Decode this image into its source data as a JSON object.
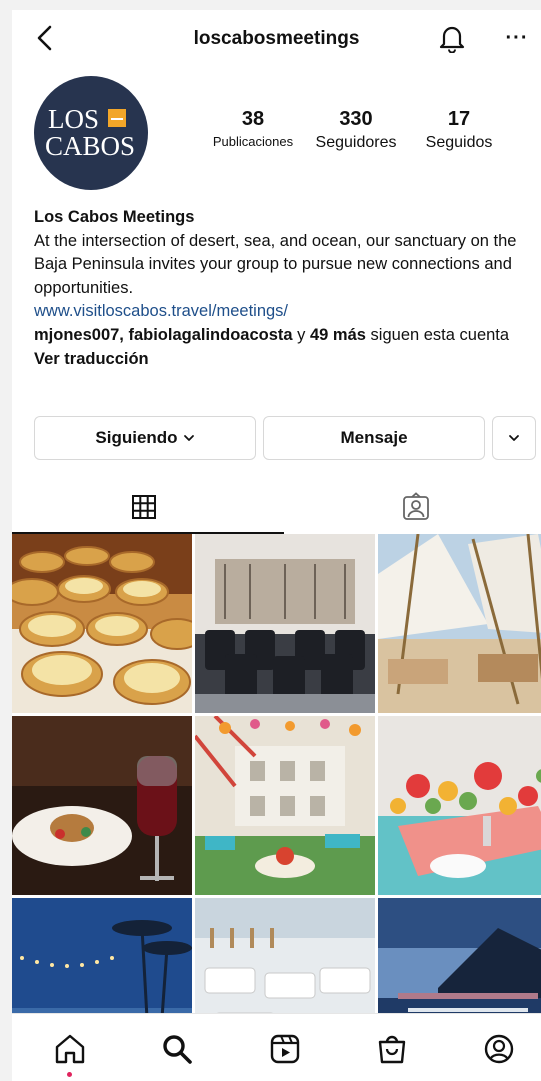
{
  "header": {
    "username": "loscabosmeetings",
    "back_icon": "chevron-left-icon",
    "bell_icon": "bell-icon",
    "more_label": "···"
  },
  "profile": {
    "avatar_line1": "LOS",
    "avatar_line2": "CABOS",
    "stats": [
      {
        "value": "38",
        "label": "Publicaciones"
      },
      {
        "value": "330",
        "label": "Seguidores"
      },
      {
        "value": "17",
        "label": "Seguidos"
      }
    ]
  },
  "bio": {
    "name": "Los Cabos Meetings",
    "text": "At the intersection of desert, sea, and ocean, our sanctuary on the Baja Peninsula invites your group to pursue new connections and opportunities.",
    "link": "www.visitloscabos.travel/meetings/",
    "followers_names": "mjones007, fabiolagalindoacosta",
    "followers_mid": " y ",
    "followers_count": "49 más",
    "followers_tail": " siguen esta cuenta",
    "translate": "Ver traducción"
  },
  "actions": {
    "following": "Siguiendo",
    "message": "Mensaje"
  },
  "tabs": [
    {
      "icon": "grid-icon"
    },
    {
      "icon": "tagged-icon"
    }
  ],
  "posts": [
    {
      "subject": "lemon tarts"
    },
    {
      "subject": "conference room"
    },
    {
      "subject": "beach tents"
    },
    {
      "subject": "plated dessert with wine"
    },
    {
      "subject": "colorful terrace"
    },
    {
      "subject": "floral table"
    },
    {
      "subject": "palm trees at dusk"
    },
    {
      "subject": "seaside lounge"
    },
    {
      "subject": "ocean sunset"
    }
  ],
  "nav": [
    {
      "icon": "home-icon"
    },
    {
      "icon": "search-icon"
    },
    {
      "icon": "reels-icon"
    },
    {
      "icon": "shop-icon"
    },
    {
      "icon": "profile-icon"
    }
  ],
  "colors": {
    "avatar_bg": "#27344f",
    "avatar_accent": "#f2a629",
    "link": "#1f4f8a",
    "notification_dot": "#e0245e"
  }
}
